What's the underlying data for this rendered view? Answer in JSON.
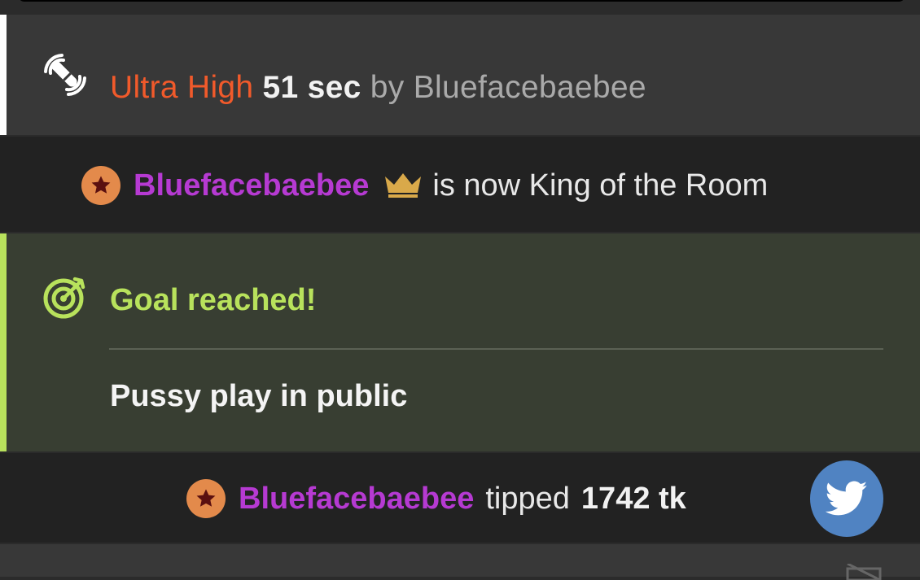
{
  "vibe_message": {
    "level": "Ultra High",
    "duration": "51 sec",
    "by_label": "by",
    "username": "Bluefacebaebee",
    "icon": "vibrator-icon"
  },
  "king_message": {
    "username": "Bluefacebaebee",
    "text": "is now King of the Room",
    "badge_icon": "star-badge-icon",
    "crown_icon": "crown-icon",
    "crown_color": "#d9a94a"
  },
  "goal_message": {
    "title": "Goal reached!",
    "description": "Pussy play in public",
    "icon": "target-icon",
    "accent": "#b8e25c"
  },
  "tip_message": {
    "username": "Bluefacebaebee",
    "verb": "tipped",
    "amount": "1742 tk",
    "badge_icon": "star-badge-icon"
  },
  "share_button": {
    "icon": "twitter-icon",
    "color": "#5083c2"
  },
  "colors": {
    "username": "#b63ad2",
    "vibe_level": "#f15a2b",
    "badge": "#e38a4b"
  }
}
